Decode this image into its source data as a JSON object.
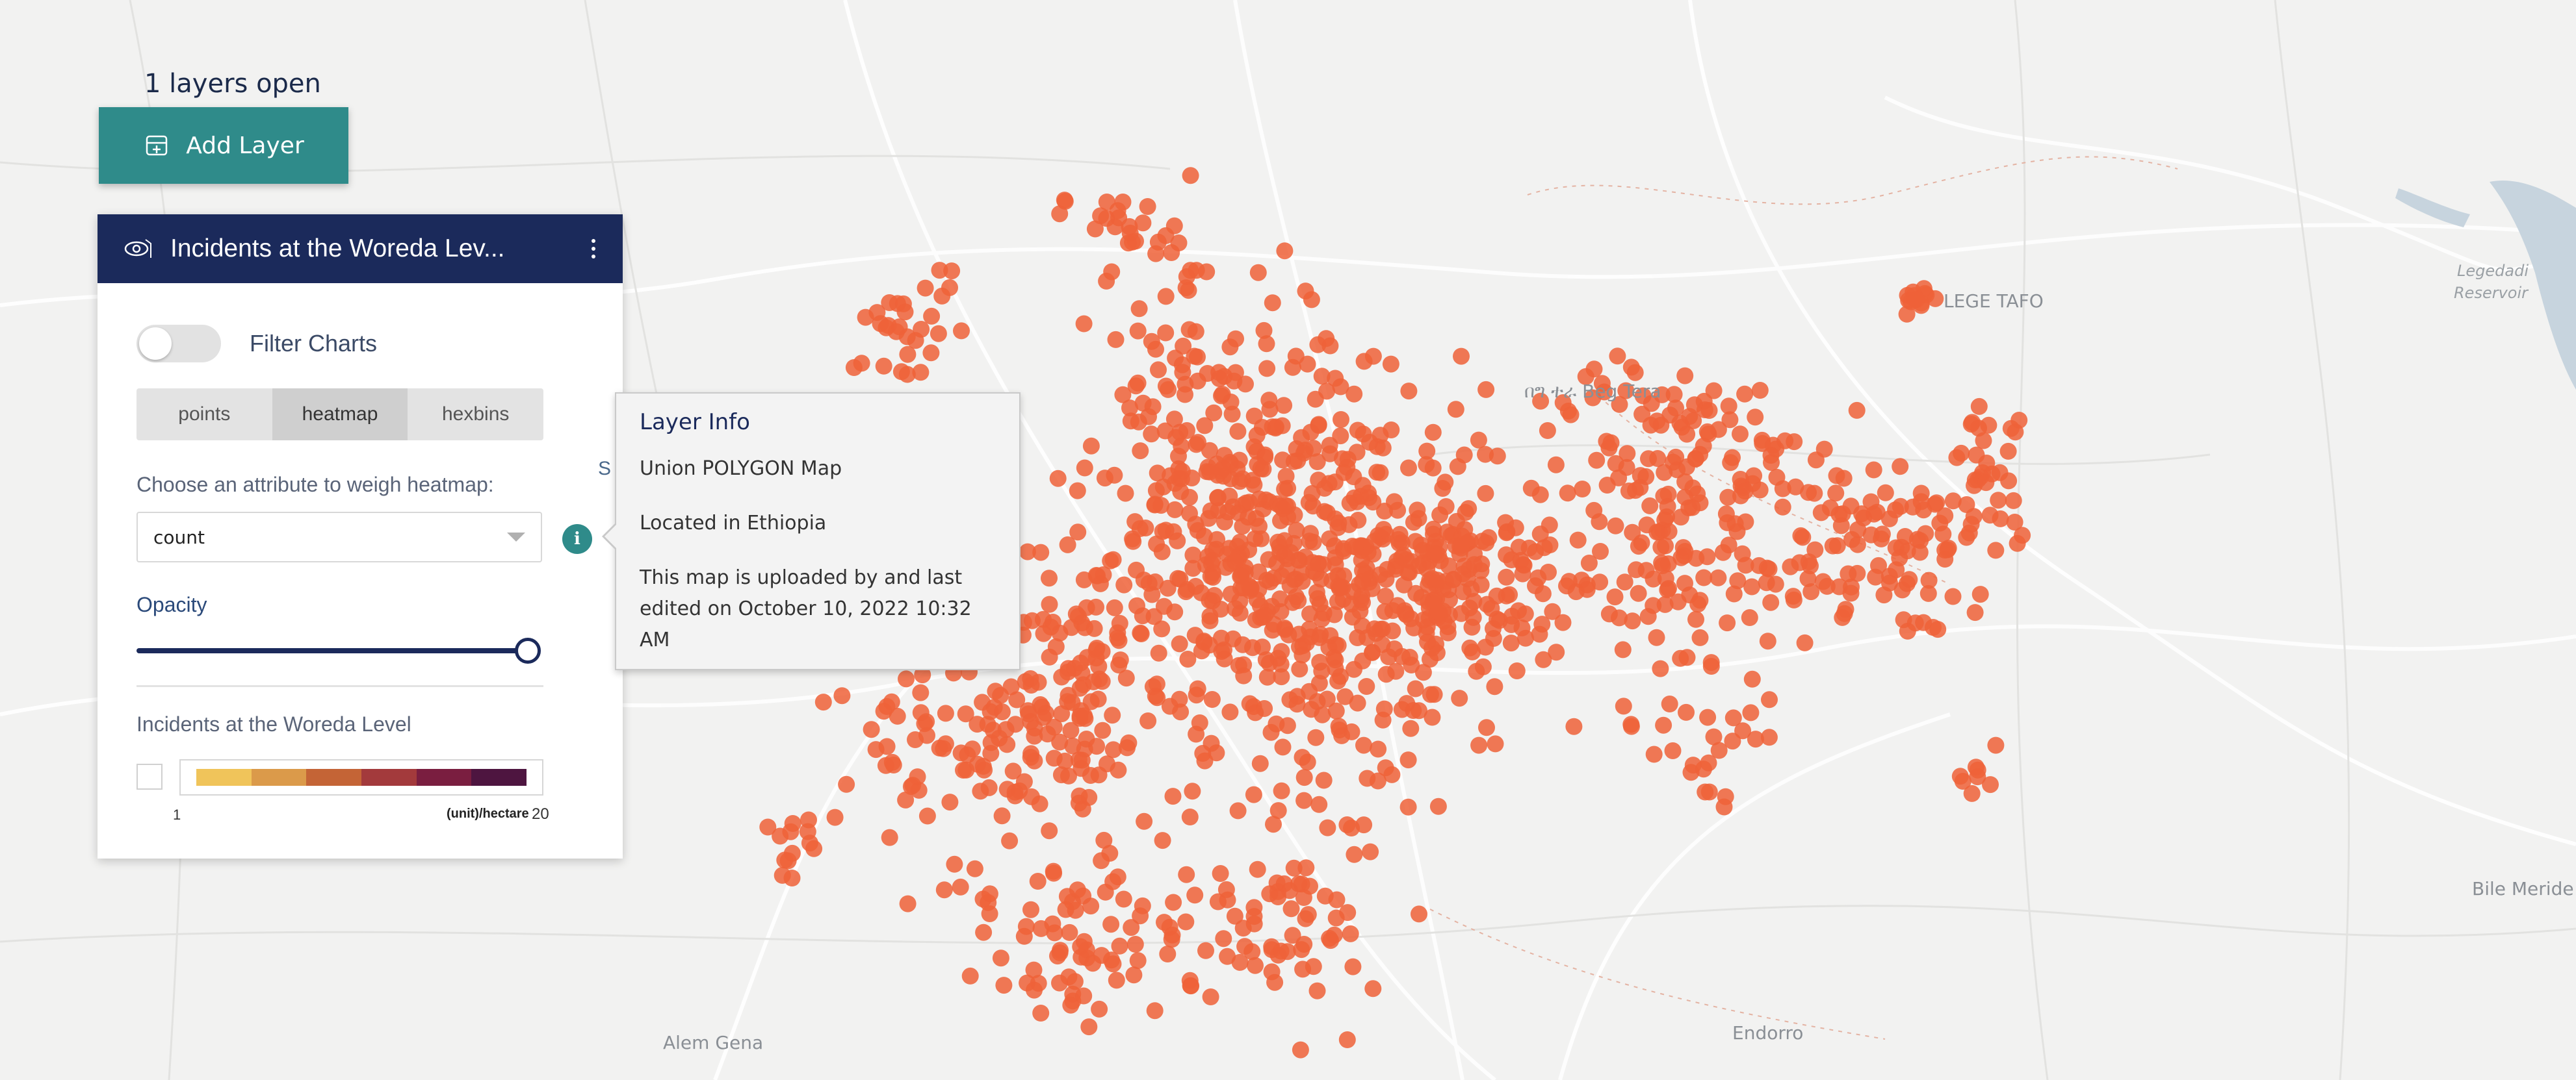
{
  "map": {
    "place_labels": [
      "Beg Tera",
      "LEGE TAFO",
      "Legedadi Reservoir",
      "Alem Gena",
      "Endorro",
      "Bile Meride"
    ],
    "beg_tera_prefix": "በግ ተራ",
    "point_color": "#ee6238"
  },
  "layers_open": "1 layers open",
  "add_layer": {
    "label": "Add Layer"
  },
  "layer_panel": {
    "title": "Incidents at the Woreda Lev...",
    "filter_label": "Filter Charts",
    "tabs": [
      {
        "label": "points"
      },
      {
        "label": "heatmap"
      },
      {
        "label": "hexbins"
      }
    ],
    "active_tab": "heatmap",
    "weigh_label": "Choose an attribute to weigh heatmap:",
    "attribute_value": "count",
    "info_icon": "i",
    "cutoff_fragment": "S",
    "opacity_label": "Opacity",
    "opacity_value": 1.0,
    "legend": {
      "title": "Incidents at the Woreda Level",
      "min": "1",
      "unit": "(unit)/hectare",
      "max": "20",
      "colors": [
        "#f0c45a",
        "#db9a4a",
        "#c46436",
        "#a33a3c",
        "#7a1e40",
        "#4e1540"
      ]
    }
  },
  "info_popup": {
    "title": "Layer Info",
    "line1": "Union POLYGON Map",
    "line2": "Located in Ethiopia",
    "line3a": "This map is uploaded by and last",
    "line3b": "edited on October 10, 2022 10:32 AM"
  }
}
